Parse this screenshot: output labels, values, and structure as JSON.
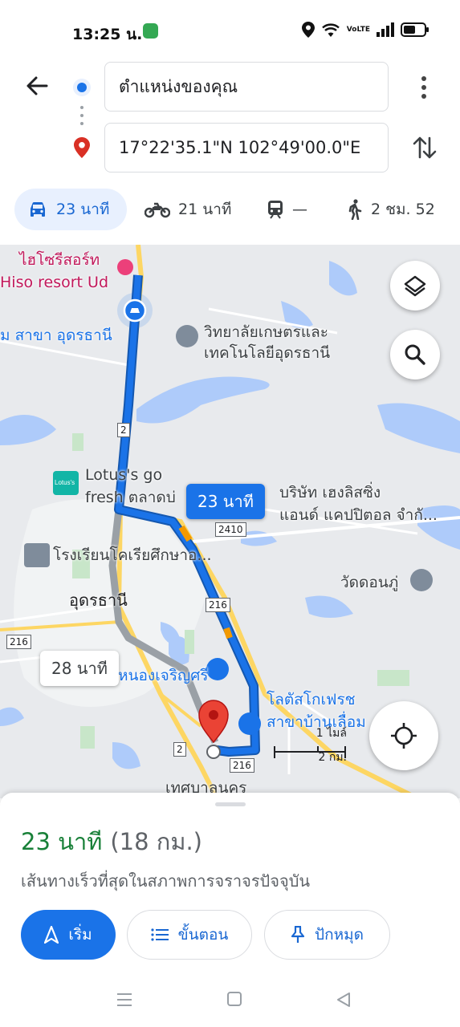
{
  "status_bar": {
    "time": "13:25 น.",
    "network": "VoLTE"
  },
  "directions": {
    "origin": "ตำแหน่งของคุณ",
    "destination": "17°22'35.1\"N 102°49'00.0\"E",
    "icons": {
      "back": "back-arrow-icon",
      "origin": "origin-dot-icon",
      "destination": "destination-pin-icon",
      "more": "more-vert-icon",
      "swap": "swap-vert-icon"
    }
  },
  "travel_modes": [
    {
      "mode": "car",
      "label": "23 นาที",
      "active": true
    },
    {
      "mode": "motorcycle",
      "label": "21 นาที",
      "active": false
    },
    {
      "mode": "transit",
      "label": "—",
      "active": false
    },
    {
      "mode": "walk",
      "label": "2 ชม. 52",
      "active": false
    }
  ],
  "map": {
    "labels": {
      "hiso_th": "ไฮโซรีสอร์ท",
      "hiso_en": "Hiso resort Ud",
      "bank": "ม สาขา อุดรธานี",
      "college_1": "วิทยาลัยเกษตรและ",
      "college_2": "เทคโนโลยีอุดรธานี",
      "lotus_go_1": "Lotus's go",
      "lotus_go_2": "fresh ตลาดบ่",
      "company_1": "บริษัท เฮงลิสซิ่ง",
      "company_2": "แอนด์ แคปปิตอล จำกั...",
      "school": "โรงเรียนโคเรียศึกษาอ...",
      "udon": "อุดรธานี",
      "temple": "วัดดอนภู่",
      "market": "ตลาดหนองเจริญศรี",
      "lotus_fresh_1": "โลตัสโกเฟรช",
      "lotus_fresh_2": "สาขาบ้านเลื่อม",
      "municipality": "เทศบาลนคร",
      "lotus_badge": "Lotus's"
    },
    "route_shields": {
      "hw2": "2",
      "hw2410": "2410",
      "hw216_a": "216",
      "hw216_b": "216",
      "hw216_c": "216",
      "hw2_b": "2"
    },
    "route_primary_label": "23 นาที",
    "route_alt_label": "28 นาที",
    "scale_mi": "1 ไมล์",
    "scale_km": "2 กม.",
    "colors": {
      "route": "#1a73e8",
      "alt_route": "#9aa0a6",
      "water": "#aecbfa",
      "park": "#c8e6c9",
      "highway": "#fdd663"
    }
  },
  "bottom_sheet": {
    "duration": "23 นาที",
    "distance": "(18 กม.)",
    "subtitle": "เส้นทางเร็วที่สุดในสภาพการจราจรปัจจุบัน",
    "start_label": "เริ่ม",
    "steps_label": "ขั้นตอน",
    "pin_label": "ปักหมุด"
  }
}
